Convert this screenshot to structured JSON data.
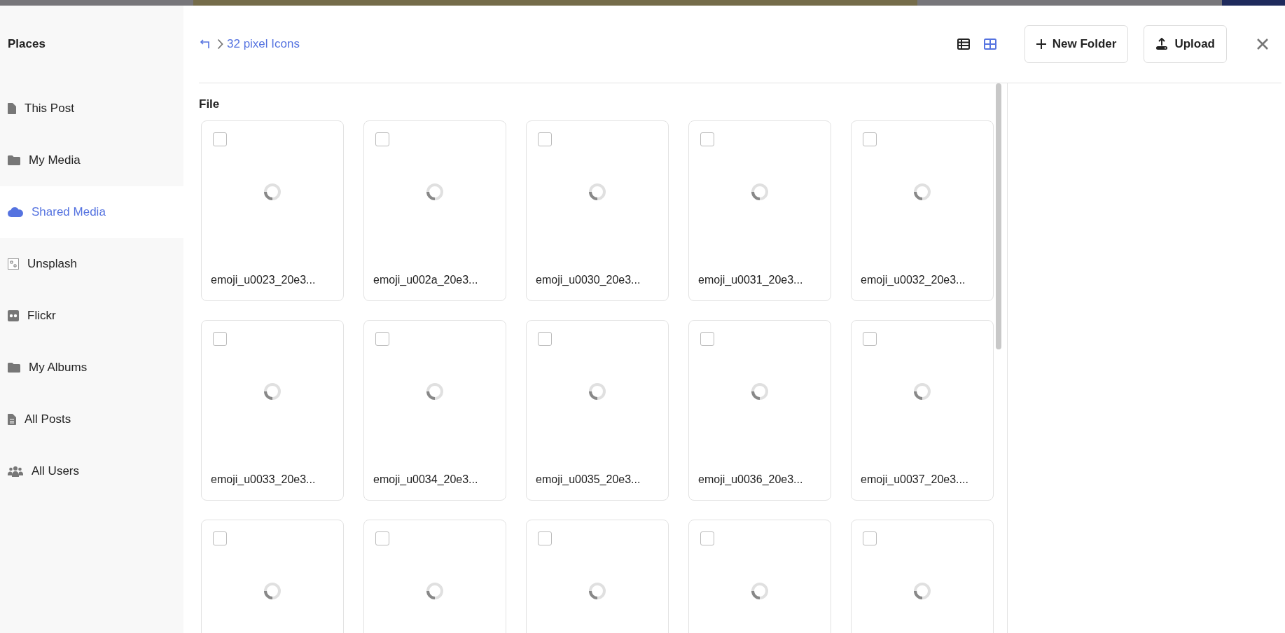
{
  "sidebar": {
    "title": "Places",
    "items": [
      {
        "label": "This Post",
        "kind": "document",
        "selected": false
      },
      {
        "label": "My Media",
        "kind": "folder",
        "selected": false
      },
      {
        "label": "Shared Media",
        "kind": "cloud",
        "selected": true
      },
      {
        "label": "Unsplash",
        "kind": "unsplash",
        "selected": false
      },
      {
        "label": "Flickr",
        "kind": "flickr",
        "selected": false
      },
      {
        "label": "My Albums",
        "kind": "folder",
        "selected": false
      },
      {
        "label": "All Posts",
        "kind": "lines",
        "selected": false
      },
      {
        "label": "All Users",
        "kind": "users",
        "selected": false
      }
    ]
  },
  "breadcrumb": {
    "current": "32 pixel Icons"
  },
  "view_modes": [
    {
      "kind": "list",
      "selected": false
    },
    {
      "kind": "grid",
      "selected": true
    }
  ],
  "buttons": [
    {
      "kind": "new-folder",
      "label": "New Folder"
    },
    {
      "kind": "upload",
      "label": "Upload"
    }
  ],
  "section_title": "File",
  "files": [
    {
      "name": "emoji_u0023_20e3...",
      "checked": false
    },
    {
      "name": "emoji_u002a_20e3...",
      "checked": false
    },
    {
      "name": "emoji_u0030_20e3...",
      "checked": false
    },
    {
      "name": "emoji_u0031_20e3...",
      "checked": false
    },
    {
      "name": "emoji_u0032_20e3...",
      "checked": false
    },
    {
      "name": "emoji_u0033_20e3...",
      "checked": false
    },
    {
      "name": "emoji_u0034_20e3...",
      "checked": false
    },
    {
      "name": "emoji_u0035_20e3...",
      "checked": false
    },
    {
      "name": "emoji_u0036_20e3...",
      "checked": false
    },
    {
      "name": "emoji_u0037_20e3....",
      "checked": false
    },
    {
      "checked": false
    },
    {
      "checked": false
    },
    {
      "checked": false
    },
    {
      "checked": false
    },
    {
      "checked": false
    }
  ]
}
